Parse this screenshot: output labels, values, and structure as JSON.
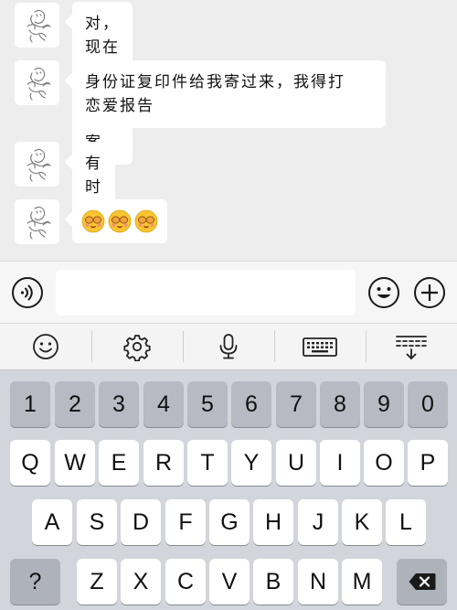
{
  "chat": {
    "messages": [
      {
        "type": "text",
        "lines": [
          "对，现在要建个这个档案"
        ]
      },
      {
        "type": "text",
        "lines": [
          "身份证复印件给我寄过来，我得打",
          "恋爱报告"
        ]
      },
      {
        "type": "text",
        "lines": [
          "有时间"
        ]
      },
      {
        "type": "emoji",
        "emoji": [
          "face-with-sunglasses-money-emoji",
          "face-with-sunglasses-money-emoji",
          "face-with-sunglasses-money-emoji"
        ]
      }
    ]
  },
  "input_bar": {
    "voice_icon": "voice-wave-icon",
    "text_value": "",
    "text_placeholder": "",
    "emoji_icon": "smiley-icon",
    "add_icon": "plus-circle-icon"
  },
  "keyboard_toolbar": [
    "smiley-icon",
    "gear-icon",
    "microphone-icon",
    "keyboard-icon",
    "keyboard-collapse-icon"
  ],
  "keyboard": {
    "numbers": [
      "1",
      "2",
      "3",
      "4",
      "5",
      "6",
      "7",
      "8",
      "9",
      "0"
    ],
    "row1": [
      "Q",
      "W",
      "E",
      "R",
      "T",
      "Y",
      "U",
      "I",
      "O",
      "P"
    ],
    "row2": [
      "A",
      "S",
      "D",
      "F",
      "G",
      "H",
      "J",
      "K",
      "L"
    ],
    "row3": [
      "Z",
      "X",
      "C",
      "V",
      "B",
      "N",
      "M"
    ],
    "symbol_key": "?",
    "delete_icon": "backspace-icon"
  },
  "colors": {
    "chat_background": "#ededed",
    "bubble": "#ffffff",
    "keyboard_background": "#d2d5db",
    "number_key": "#b7bac2"
  }
}
